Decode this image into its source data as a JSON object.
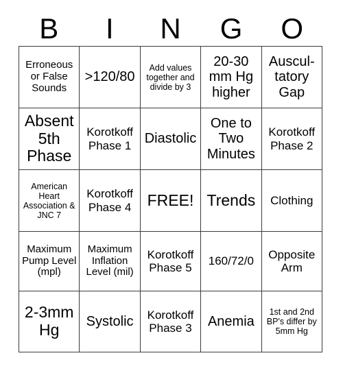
{
  "card": {
    "title_letters": [
      "B",
      "I",
      "N",
      "G",
      "O"
    ],
    "columns": 5,
    "rows": 5,
    "free_space": {
      "row": 3,
      "column": 3,
      "label": "FREE!"
    },
    "colors": {
      "background": "#ffffff",
      "text": "#000000",
      "grid_line": "#3a3a3a"
    },
    "cells": [
      [
        {
          "text": "Erroneous or False Sounds",
          "size": "sz-s"
        },
        {
          "text": ">120/80",
          "size": "sz-l"
        },
        {
          "text": "Add values together and divide by 3",
          "size": "sz-xs"
        },
        {
          "text": "20-30 mm Hg higher",
          "size": "sz-l"
        },
        {
          "text": "Auscul-tatory Gap",
          "size": "sz-l"
        }
      ],
      [
        {
          "text": "Absent 5th Phase",
          "size": "sz-xl"
        },
        {
          "text": "Korotkoff Phase 1",
          "size": "sz-m"
        },
        {
          "text": "Diastolic",
          "size": "sz-l"
        },
        {
          "text": "One to Two Minutes",
          "size": "sz-l"
        },
        {
          "text": "Korotkoff Phase 2",
          "size": "sz-m"
        }
      ],
      [
        {
          "text": "American Heart Association & JNC 7",
          "size": "sz-xs"
        },
        {
          "text": "Korotkoff Phase 4",
          "size": "sz-m"
        },
        {
          "text": "FREE!",
          "size": "sz-xl"
        },
        {
          "text": "Trends",
          "size": "sz-xl"
        },
        {
          "text": "Clothing",
          "size": "sz-m"
        }
      ],
      [
        {
          "text": "Maximum Pump Level (mpl)",
          "size": "sz-s"
        },
        {
          "text": "Maximum Inflation Level (mil)",
          "size": "sz-s"
        },
        {
          "text": "Korotkoff Phase 5",
          "size": "sz-m"
        },
        {
          "text": "160/72/0",
          "size": "sz-m"
        },
        {
          "text": "Opposite Arm",
          "size": "sz-m"
        }
      ],
      [
        {
          "text": "2-3mm Hg",
          "size": "sz-xl"
        },
        {
          "text": "Systolic",
          "size": "sz-l"
        },
        {
          "text": "Korotkoff Phase 3",
          "size": "sz-m"
        },
        {
          "text": "Anemia",
          "size": "sz-l"
        },
        {
          "text": "1st and 2nd BP's differ by 5mm Hg",
          "size": "sz-xs"
        }
      ]
    ]
  }
}
